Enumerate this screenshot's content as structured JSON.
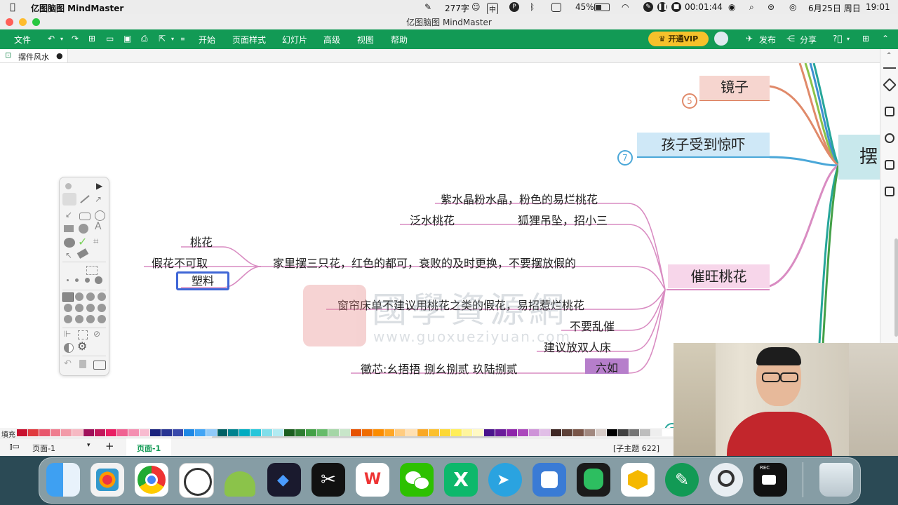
{
  "menubar": {
    "app_name": "亿图脑图 MindMaster",
    "word_count": "277字",
    "input_method": "中",
    "p_badge": "P",
    "battery": "45%",
    "timer": "00:01:44",
    "date": "6月25日 周日",
    "time": "19:01"
  },
  "window": {
    "title": "亿图脑图 MindMaster"
  },
  "toolbar": {
    "file": "文件",
    "menus": [
      "开始",
      "页面样式",
      "幻灯片",
      "高级",
      "视图",
      "帮助"
    ],
    "vip": "开通VIP",
    "publish": "发布",
    "share": "分享"
  },
  "tab": {
    "doc_name": "摆件风水"
  },
  "mindmap": {
    "root_partial": "摆",
    "topics": [
      {
        "label": "镜子",
        "badge": "5",
        "color": "#f6d5cf",
        "line": "#e08a6a"
      },
      {
        "label": "孩子受到惊吓",
        "badge": "7",
        "color": "#cfe8f7",
        "line": "#4aa7d8"
      },
      {
        "label": "催旺桃花",
        "color": "#f7d6ea",
        "line": "#d98cc2"
      }
    ],
    "subtopics": [
      "紫水晶粉水晶，粉色的易烂桃花",
      "泛水桃花",
      "狐狸吊坠，招小三",
      "家里摆三只花，红色的都可，衰败的及时更换，不要摆放假的",
      "窗帘床单不建议用桃花之类的假花，易招惹烂桃花",
      "不要乱催",
      "建议放双人床",
      "六如"
    ],
    "symbols_text": "黴芯:幺捂捂 捌幺捌贰 玖陆捌贰",
    "left_items": [
      "桃花",
      "假花不可取",
      "塑料"
    ]
  },
  "watermark": {
    "cn": "國學資源網",
    "url": "www.guoxueziyuan.com"
  },
  "palette": {
    "label": "填充",
    "colors": [
      "#c8102e",
      "#e03a3e",
      "#e8566c",
      "#ef7d8f",
      "#f29aa8",
      "#f6b9c3",
      "#a0105a",
      "#c2185b",
      "#e91e63",
      "#f06292",
      "#f48fb1",
      "#f8bbd0",
      "#1a237e",
      "#283593",
      "#3949ab",
      "#1e88e5",
      "#42a5f5",
      "#90caf9",
      "#006064",
      "#00838f",
      "#00acc1",
      "#26c6da",
      "#80deea",
      "#b2ebf2",
      "#1b5e20",
      "#2e7d32",
      "#43a047",
      "#66bb6a",
      "#a5d6a7",
      "#c8e6c9",
      "#e65100",
      "#ef6c00",
      "#fb8c00",
      "#ffa726",
      "#ffcc80",
      "#ffe0b2",
      "#f9a825",
      "#fbc02d",
      "#fdd835",
      "#ffee58",
      "#fff59d",
      "#fff9c4",
      "#4a148c",
      "#6a1b9a",
      "#8e24aa",
      "#ab47bc",
      "#ce93d8",
      "#e1bee7",
      "#3e2723",
      "#5d4037",
      "#795548",
      "#a1887f",
      "#d7ccc8",
      "#000000",
      "#424242",
      "#757575",
      "#bdbdbd",
      "#eeeeee",
      "#ffffff"
    ]
  },
  "statusbar": {
    "page_select": "页面-1",
    "active_page": "页面-1",
    "subtopic_count": "[子主题 622]"
  },
  "dock": {
    "apps": [
      "Finder",
      "Launchpad",
      "Chrome",
      "Aperture",
      "Android Studio",
      "Infuse",
      "CapCut",
      "WPS",
      "WeChat",
      "Xmind",
      "Telegram",
      "Docs",
      "Evernote",
      "Pages",
      "MindMaster",
      "Webcam",
      "Screen Recorder",
      "Trash"
    ],
    "rec_label": "REC"
  }
}
